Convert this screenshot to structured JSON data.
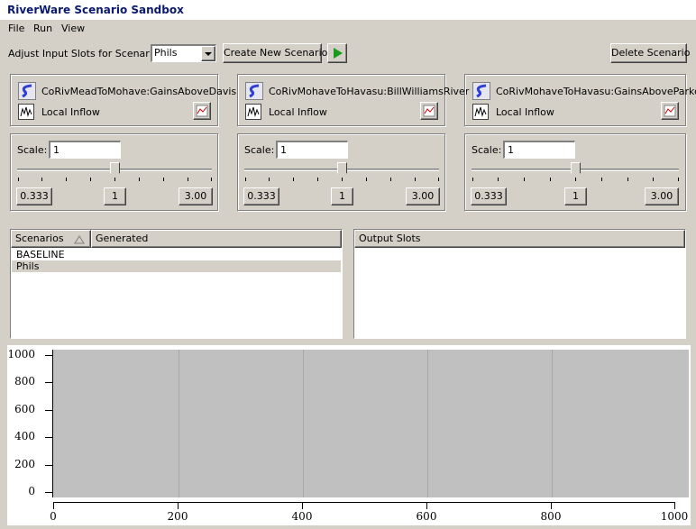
{
  "window": {
    "title": "RiverWare Scenario Sandbox"
  },
  "menu": [
    "File",
    "Run",
    "View"
  ],
  "toolbar": {
    "adjust_label": "Adjust Input Slots for Scenario:",
    "scenario_selected": "Phils",
    "create_label": "Create New Scenario",
    "delete_label": "Delete Scenario"
  },
  "slots": [
    {
      "object": "CoRivMeadToMohave:GainsAboveDavis",
      "slot": "Local Inflow",
      "scale_label": "Scale:",
      "scale_value": "1",
      "min": "0.333",
      "mid": "1",
      "max": "3.00"
    },
    {
      "object": "CoRivMohaveToHavasu:BillWilliamsRiver",
      "slot": "Local Inflow",
      "scale_label": "Scale:",
      "scale_value": "1",
      "min": "0.333",
      "mid": "1",
      "max": "3.00"
    },
    {
      "object": "CoRivMohaveToHavasu:GainsAboveParker",
      "slot": "Local Inflow",
      "scale_label": "Scale:",
      "scale_value": "1",
      "min": "0.333",
      "mid": "1",
      "max": "3.00"
    }
  ],
  "scenarios_table": {
    "columns": [
      "Scenarios",
      "Generated"
    ],
    "rows": [
      "BASELINE",
      "Phils"
    ]
  },
  "output_table": {
    "columns": [
      "Output Slots"
    ]
  },
  "plot": {
    "y_ticks": [
      "1000",
      "800",
      "600",
      "400",
      "200",
      "0"
    ],
    "x_ticks": [
      "0",
      "200",
      "400",
      "600",
      "800",
      "1000"
    ]
  },
  "colors": {
    "title_text": "#0b1a6e",
    "play_green": "#1a9a1a",
    "selected_row": "#d4d0c8"
  }
}
